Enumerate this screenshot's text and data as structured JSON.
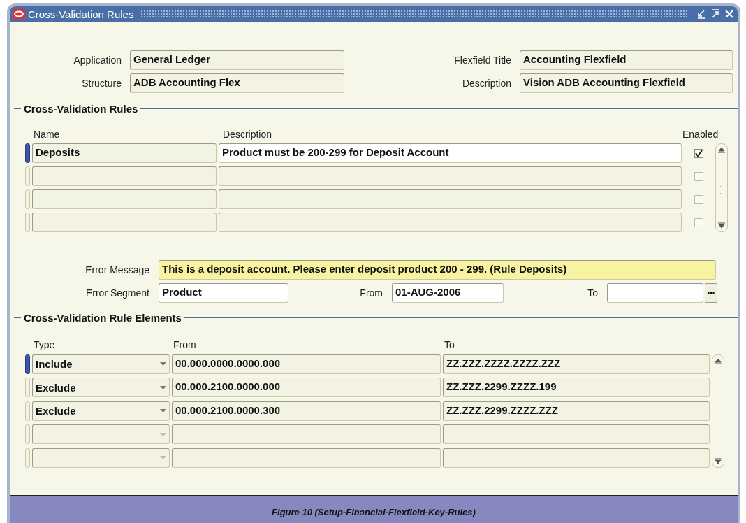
{
  "window": {
    "title": "Cross-Validation Rules"
  },
  "header_fields": [
    {
      "label": "Application",
      "value": "General Ledger"
    },
    {
      "label": "Flexfield Title",
      "value": "Accounting Flexfield"
    },
    {
      "label": "Structure",
      "value": "ADB Accounting Flex"
    },
    {
      "label": "Description",
      "value": "Vision ADB Accounting Flexfield"
    }
  ],
  "rules_section": {
    "title": "Cross-Validation Rules",
    "columns": [
      "Name",
      "Description",
      "Enabled"
    ],
    "rows": [
      {
        "name": "Deposits",
        "description": "Product must be 200-299 for Deposit Account",
        "enabled": true,
        "selected": true
      },
      {
        "enabled": false,
        "selected": false
      },
      {
        "enabled": false,
        "selected": false
      },
      {
        "enabled": false,
        "selected": false
      }
    ]
  },
  "error_message": {
    "label": "Error Message",
    "value": "This is a deposit account.  Please enter deposit product 200 - 299. (Rule Deposits)"
  },
  "error_segment": {
    "label": "Error Segment",
    "value": "Product"
  },
  "from_date": {
    "label": "From",
    "value": "01-AUG-2006"
  },
  "to_date": {
    "label": "To"
  },
  "elements_section": {
    "title": "Cross-Validation Rule Elements",
    "columns": [
      "Type",
      "From",
      "To"
    ],
    "rows": [
      {
        "type": "Include",
        "from": "00.000.0000.0000.000",
        "to": "ZZ.ZZZ.ZZZZ.ZZZZ.ZZZ",
        "selected": true
      },
      {
        "type": "Exclude",
        "from": "00.000.2100.0000.000",
        "to": "ZZ.ZZZ.2299.ZZZZ.199",
        "selected": false
      },
      {
        "type": "Exclude",
        "from": "00.000.2100.0000.300",
        "to": "ZZ.ZZZ.2299.ZZZZ.ZZZ",
        "selected": false
      },
      {
        "selected": false
      },
      {
        "selected": false
      }
    ]
  },
  "caption": "Figure 10 (Setup-Financial-Flexfield-Key-Rules)"
}
